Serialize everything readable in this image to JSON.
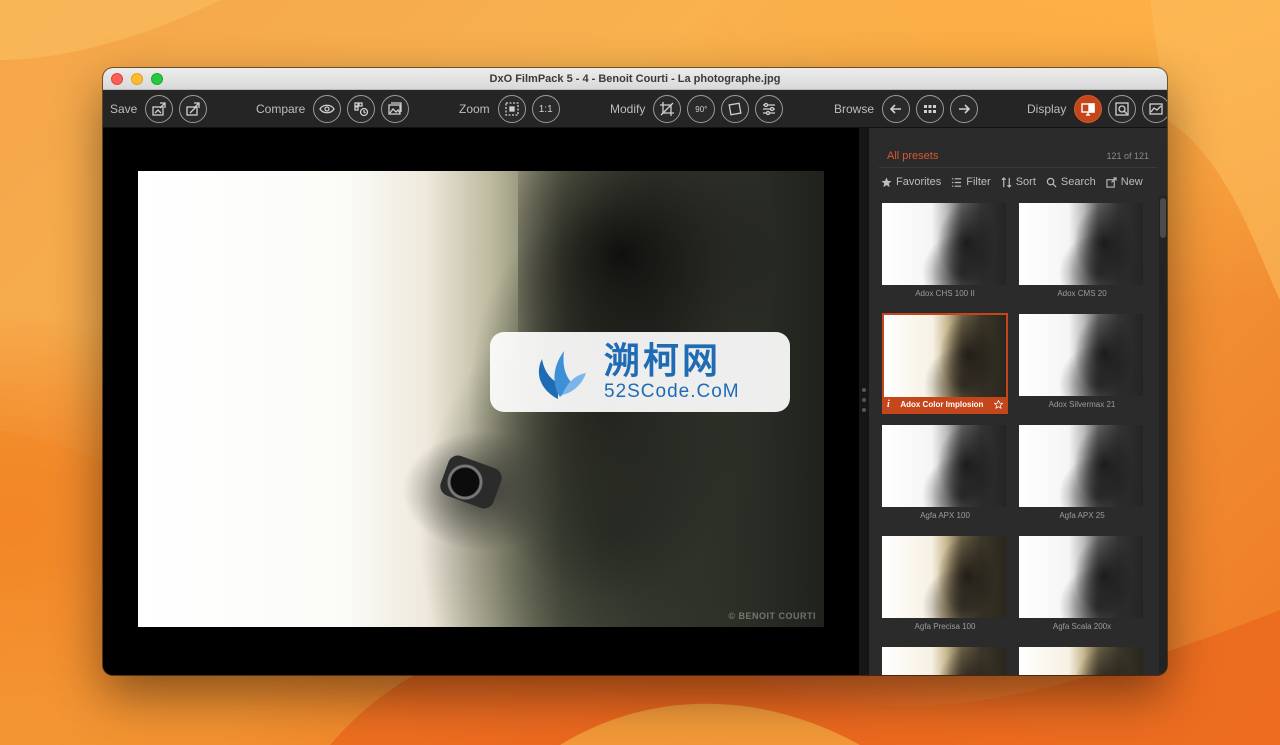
{
  "window": {
    "title": "DxO FilmPack 5 - 4 - Benoit Courti - La photographe.jpg"
  },
  "toolbar": {
    "save_label": "Save",
    "compare_label": "Compare",
    "zoom_label": "Zoom",
    "zoom_one_to_one": "1:1",
    "modify_label": "Modify",
    "rotate_label": "90°",
    "browse_label": "Browse",
    "display_label": "Display"
  },
  "photo": {
    "credit": "© BENOIT COURTI"
  },
  "watermark": {
    "chinese": "溯柯网",
    "english": "52SCode.CoM"
  },
  "panel": {
    "preset_title": "All presets",
    "preset_count": "121 of 121",
    "tools": [
      {
        "label": "Favorites",
        "icon": "star-icon"
      },
      {
        "label": "Filter",
        "icon": "list-icon"
      },
      {
        "label": "Sort",
        "icon": "sort-icon"
      },
      {
        "label": "Search",
        "icon": "search-icon"
      },
      {
        "label": "New",
        "icon": "new-preset-icon"
      }
    ],
    "presets": [
      {
        "name": "Adox CHS 100 II"
      },
      {
        "name": "Adox CMS 20"
      },
      {
        "name": "Adox Color Implosion",
        "selected": true
      },
      {
        "name": "Adox Silvermax 21"
      },
      {
        "name": "Agfa APX 100"
      },
      {
        "name": "Agfa APX 25"
      },
      {
        "name": "Agfa Precisa 100"
      },
      {
        "name": "Agfa Scala 200x"
      }
    ]
  },
  "colors": {
    "accent": "#c4461a",
    "toolbar": "#252525",
    "panel": "#2b2b2b"
  }
}
